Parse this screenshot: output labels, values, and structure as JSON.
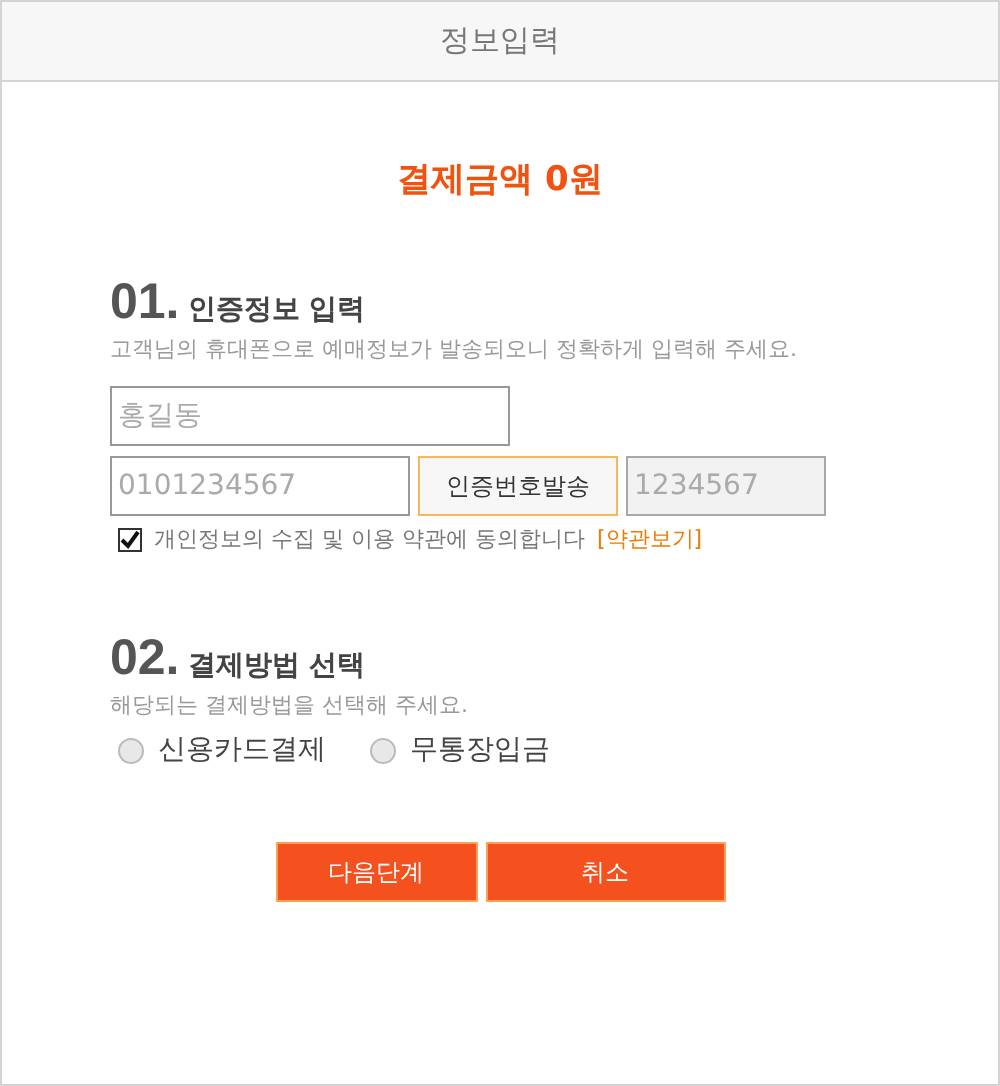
{
  "window": {
    "title": "정보입력"
  },
  "amount": "결제금액 0원",
  "sections": [
    {
      "number": "01.",
      "title": "인증정보 입력",
      "description": "고객님의 휴대폰으로 예매정보가 발송되오니 정확하게 입력해 주세요."
    },
    {
      "number": "02.",
      "title": "결제방법 선택",
      "description": "해당되는 결제방법을 선택해 주세요."
    }
  ],
  "name_field": {
    "placeholder": "홍길동"
  },
  "phone_field": {
    "placeholder": "0101234567"
  },
  "send_code_button": "인증번호발송",
  "code_field": {
    "placeholder": "1234567",
    "disabled": true
  },
  "consent": {
    "label": "개인정보의 수집 및 이용 약관에 동의합니다",
    "link": "[약관보기]",
    "checked": true
  },
  "payment_methods": [
    {
      "label": "신용카드결제",
      "selected": false
    },
    {
      "label": "무통장입금",
      "selected": false
    }
  ],
  "buttons": [
    "다음단계",
    "취소"
  ]
}
